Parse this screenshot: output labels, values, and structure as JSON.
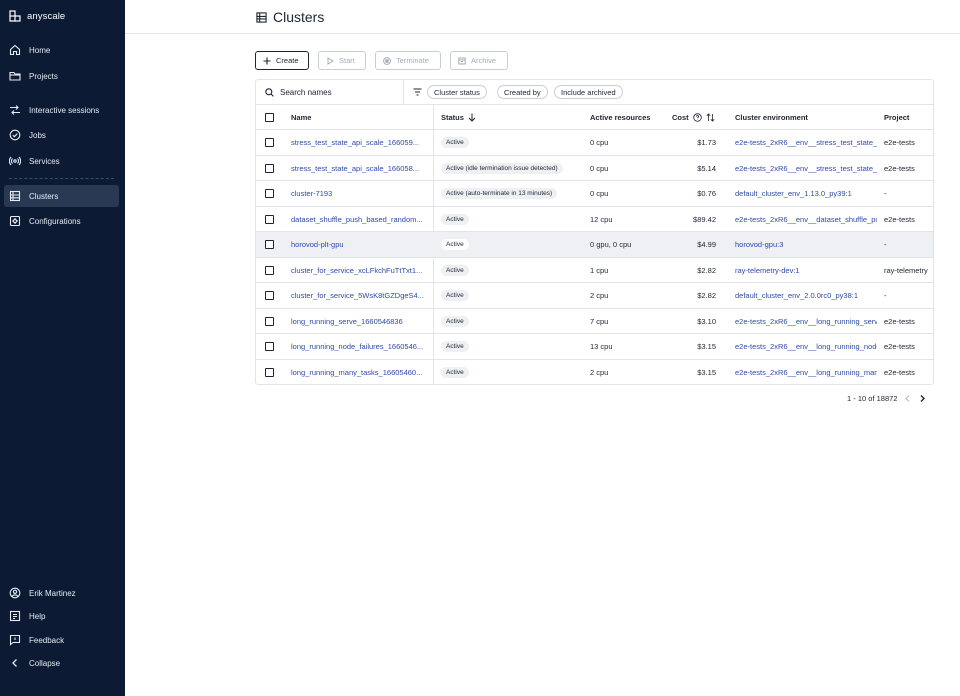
{
  "app": {
    "brand": "anyscale"
  },
  "sidebar": {
    "items": [
      {
        "label": "Home",
        "icon": "home-icon"
      },
      {
        "label": "Projects",
        "icon": "folder-icon"
      },
      {
        "label": "Interactive sessions",
        "icon": "sessions-icon"
      },
      {
        "label": "Jobs",
        "icon": "jobs-icon"
      },
      {
        "label": "Services",
        "icon": "services-icon"
      },
      {
        "label": "Clusters",
        "icon": "clusters-icon",
        "active": true
      },
      {
        "label": "Configurations",
        "icon": "configurations-icon"
      }
    ],
    "bottom": [
      {
        "label": "Erik Martinez",
        "icon": "user-icon"
      },
      {
        "label": "Help",
        "icon": "help-icon"
      },
      {
        "label": "Feedback",
        "icon": "feedback-icon"
      },
      {
        "label": "Collapse",
        "icon": "chevron-left-icon"
      }
    ]
  },
  "header": {
    "title": "Clusters"
  },
  "toolbar": {
    "create": "Create",
    "start": "Start",
    "terminate": "Terminate",
    "archive": "Archive"
  },
  "filters": {
    "search_placeholder": "Search names",
    "chips": [
      "Cluster status",
      "Created by",
      "Include archived"
    ]
  },
  "table": {
    "columns": {
      "name": "Name",
      "status": "Status",
      "resources": "Active resources",
      "cost": "Cost",
      "environment": "Cluster environment",
      "project": "Project"
    },
    "rows": [
      {
        "name": "stress_test_state_api_scale_166059...",
        "status": "Active",
        "resources": "0 cpu",
        "cost": "$1.73",
        "environment": "e2e-tests_2xR6__env__stress_test_state_",
        "project": "e2e-tests"
      },
      {
        "name": "stress_test_state_api_scale_166058...",
        "status": "Active (idle termination issue detected)",
        "resources": "0 cpu",
        "cost": "$5.14",
        "environment": "e2e-tests_2xR6__env__stress_test_state_",
        "project": "e2e-tests"
      },
      {
        "name": "cluster-7193",
        "status": "Active (auto-terminate in 13 minutes)",
        "resources": "0 cpu",
        "cost": "$0.76",
        "environment": "default_cluster_env_1.13.0_py39:1",
        "project": "-"
      },
      {
        "name": "dataset_shuffle_push_based_random...",
        "status": "Active",
        "resources": "12 cpu",
        "cost": "$89.42",
        "environment": "e2e-tests_2xR6__env__dataset_shuffle_pu",
        "project": "e2e-tests"
      },
      {
        "name": "horovod-plt-gpu",
        "status": "Active",
        "resources": "0 gpu, 0 cpu",
        "cost": "$4.99",
        "environment": "horovod-gpu:3",
        "project": "-"
      },
      {
        "name": "cluster_for_service_xcLFkchFuTtTxt1...",
        "status": "Active",
        "resources": "1 cpu",
        "cost": "$2.82",
        "environment": "ray-telemetry-dev:1",
        "project": "ray-telemetry"
      },
      {
        "name": "cluster_for_service_5WsK8tGZDgeS4...",
        "status": "Active",
        "resources": "2 cpu",
        "cost": "$2.82",
        "environment": "default_cluster_env_2.0.0rc0_py38:1",
        "project": "-"
      },
      {
        "name": "long_running_serve_1660546836",
        "status": "Active",
        "resources": "7 cpu",
        "cost": "$3.10",
        "environment": "e2e-tests_2xR6__env__long_running_serve",
        "project": "e2e-tests"
      },
      {
        "name": "long_running_node_failures_1660546...",
        "status": "Active",
        "resources": "13 cpu",
        "cost": "$3.15",
        "environment": "e2e-tests_2xR6__env__long_running_node",
        "project": "e2e-tests"
      },
      {
        "name": "long_running_many_tasks_16605460...",
        "status": "Active",
        "resources": "2 cpu",
        "cost": "$3.15",
        "environment": "e2e-tests_2xR6__env__long_running_man",
        "project": "e2e-tests"
      }
    ]
  },
  "pagination": {
    "text": "1 - 10 of 18872"
  }
}
